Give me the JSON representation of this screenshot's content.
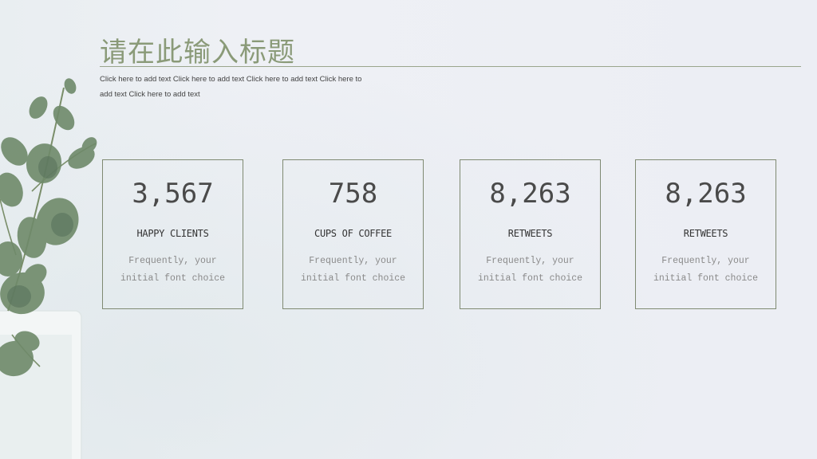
{
  "slide": {
    "title": "请在此输入标题",
    "subtitle": "Click here to add text Click here to add text Click here to add text Click here to add text Click here to add text"
  },
  "stats": [
    {
      "value": "3,567",
      "label": "HAPPY CLIENTS",
      "description": "Frequently, your initial font choice"
    },
    {
      "value": "758",
      "label": "CUPS OF COFFEE",
      "description": "Frequently, your initial font choice"
    },
    {
      "value": "8,263",
      "label": "RETWEETS",
      "description": "Frequently, your initial font choice"
    },
    {
      "value": "8,263",
      "label": "RETWEETS",
      "description": "Frequently, your initial font choice"
    }
  ],
  "colors": {
    "title": "#8a9a78",
    "rule": "#9aa58c",
    "card_border": "#7f8a72",
    "leaf": "#6f8a6a"
  },
  "icons": [
    "eucalyptus-plant-decoration"
  ]
}
